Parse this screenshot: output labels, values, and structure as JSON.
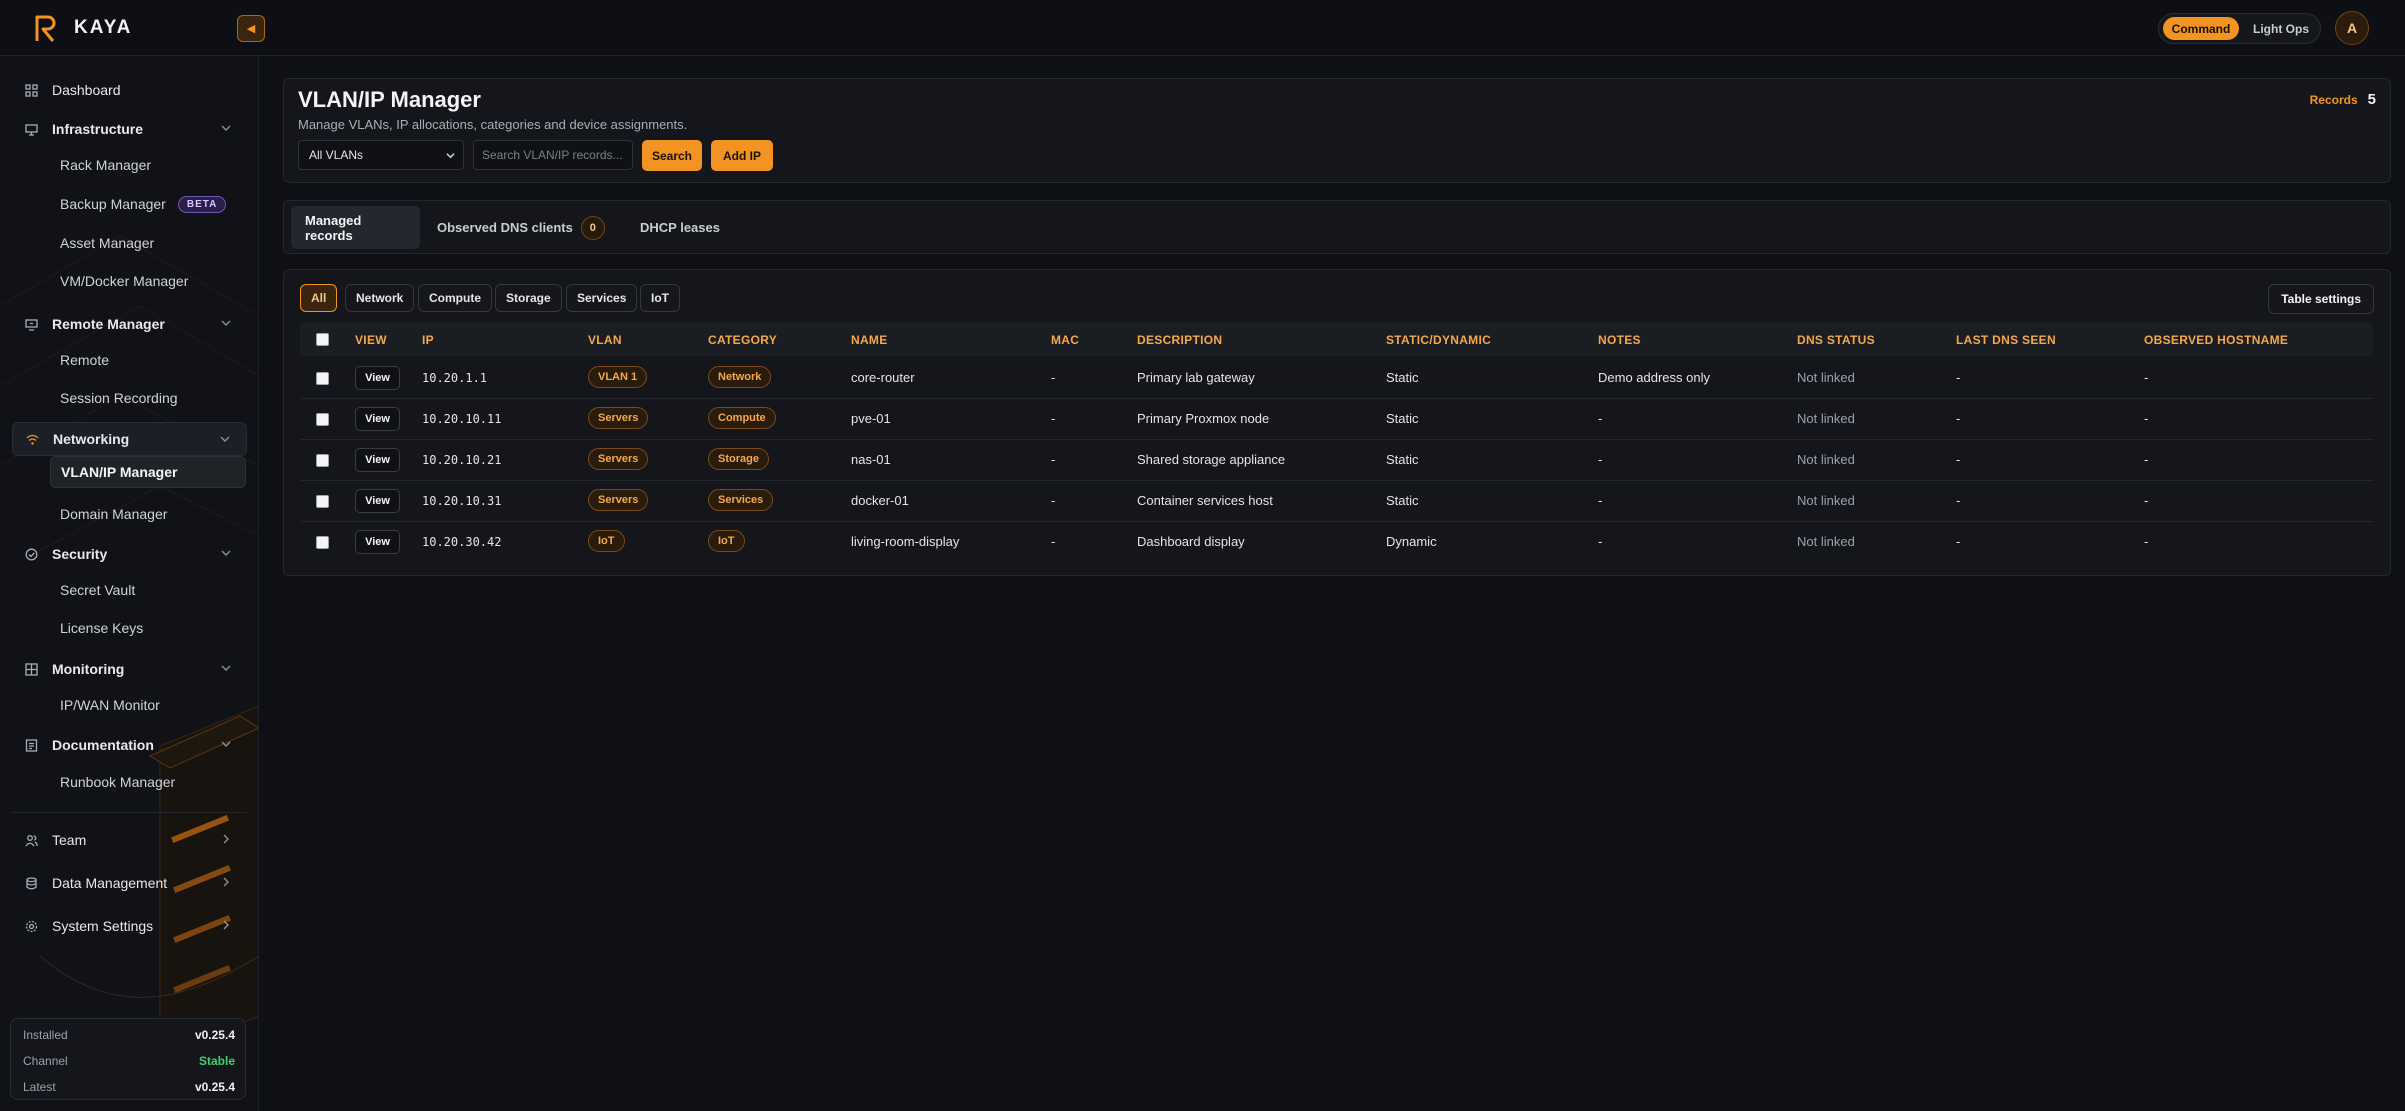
{
  "brand": {
    "name": "KAYA"
  },
  "topbar": {
    "mode_active": "Command",
    "mode_other": "Light Ops",
    "avatar": "A"
  },
  "sidebar": {
    "dashboard": "Dashboard",
    "infrastructure": "Infrastructure",
    "rack_manager": "Rack Manager",
    "backup_manager": "Backup Manager",
    "beta_badge": "BETA",
    "asset_manager": "Asset Manager",
    "vm_docker_manager": "VM/Docker Manager",
    "remote_manager": "Remote Manager",
    "remote": "Remote",
    "session_recording": "Session Recording",
    "networking": "Networking",
    "vlan_ip_manager": "VLAN/IP Manager",
    "domain_manager": "Domain Manager",
    "security": "Security",
    "secret_vault": "Secret Vault",
    "license_keys": "License Keys",
    "monitoring": "Monitoring",
    "ip_wan_monitor": "IP/WAN Monitor",
    "documentation": "Documentation",
    "runbook_manager": "Runbook Manager",
    "team": "Team",
    "data_management": "Data Management",
    "system_settings": "System Settings"
  },
  "version": {
    "installed_label": "Installed",
    "installed_value": "v0.25.4",
    "channel_label": "Channel",
    "channel_value": "Stable",
    "latest_label": "Latest",
    "latest_value": "v0.25.4"
  },
  "header": {
    "title": "VLAN/IP Manager",
    "subtitle": "Manage VLANs, IP allocations, categories and device assignments.",
    "records_label": "Records",
    "records_count": "5",
    "vlan_select": "All VLANs",
    "search_placeholder": "Search VLAN/IP records...",
    "search_button": "Search",
    "add_button": "Add IP"
  },
  "tabs": {
    "managed": "Managed records",
    "observed": "Observed DNS clients",
    "observed_count": "0",
    "dhcp": "DHCP leases"
  },
  "filters": {
    "all": "All",
    "network": "Network",
    "compute": "Compute",
    "storage": "Storage",
    "services": "Services",
    "iot": "IoT",
    "table_settings": "Table settings"
  },
  "table": {
    "columns": {
      "view": "VIEW",
      "ip": "IP",
      "vlan": "VLAN",
      "category": "CATEGORY",
      "name": "NAME",
      "mac": "MAC",
      "description": "DESCRIPTION",
      "static_dynamic": "STATIC/DYNAMIC",
      "notes": "NOTES",
      "dns_status": "DNS STATUS",
      "last_dns_seen": "LAST DNS SEEN",
      "observed_hostname": "OBSERVED HOSTNAME"
    },
    "view_label": "View",
    "rows": [
      {
        "ip": "10.20.1.1",
        "vlan": "VLAN 1",
        "category": "Network",
        "name": "core-router",
        "mac": "-",
        "description": "Primary lab gateway",
        "mode": "Static",
        "notes": "Demo address only",
        "dns_status": "Not linked",
        "last_dns": "-",
        "hostname": "-"
      },
      {
        "ip": "10.20.10.11",
        "vlan": "Servers",
        "category": "Compute",
        "name": "pve-01",
        "mac": "-",
        "description": "Primary Proxmox node",
        "mode": "Static",
        "notes": "-",
        "dns_status": "Not linked",
        "last_dns": "-",
        "hostname": "-"
      },
      {
        "ip": "10.20.10.21",
        "vlan": "Servers",
        "category": "Storage",
        "name": "nas-01",
        "mac": "-",
        "description": "Shared storage appliance",
        "mode": "Static",
        "notes": "-",
        "dns_status": "Not linked",
        "last_dns": "-",
        "hostname": "-"
      },
      {
        "ip": "10.20.10.31",
        "vlan": "Servers",
        "category": "Services",
        "name": "docker-01",
        "mac": "-",
        "description": "Container services host",
        "mode": "Static",
        "notes": "-",
        "dns_status": "Not linked",
        "last_dns": "-",
        "hostname": "-"
      },
      {
        "ip": "10.20.30.42",
        "vlan": "IoT",
        "category": "IoT",
        "name": "living-room-display",
        "mac": "-",
        "description": "Dashboard display",
        "mode": "Dynamic",
        "notes": "-",
        "dns_status": "Not linked",
        "last_dns": "-",
        "hostname": "-"
      }
    ]
  },
  "colors": {
    "accent": "#f39321",
    "background": "#0e1015",
    "panel": "#14161b",
    "success": "#3fd16a"
  }
}
